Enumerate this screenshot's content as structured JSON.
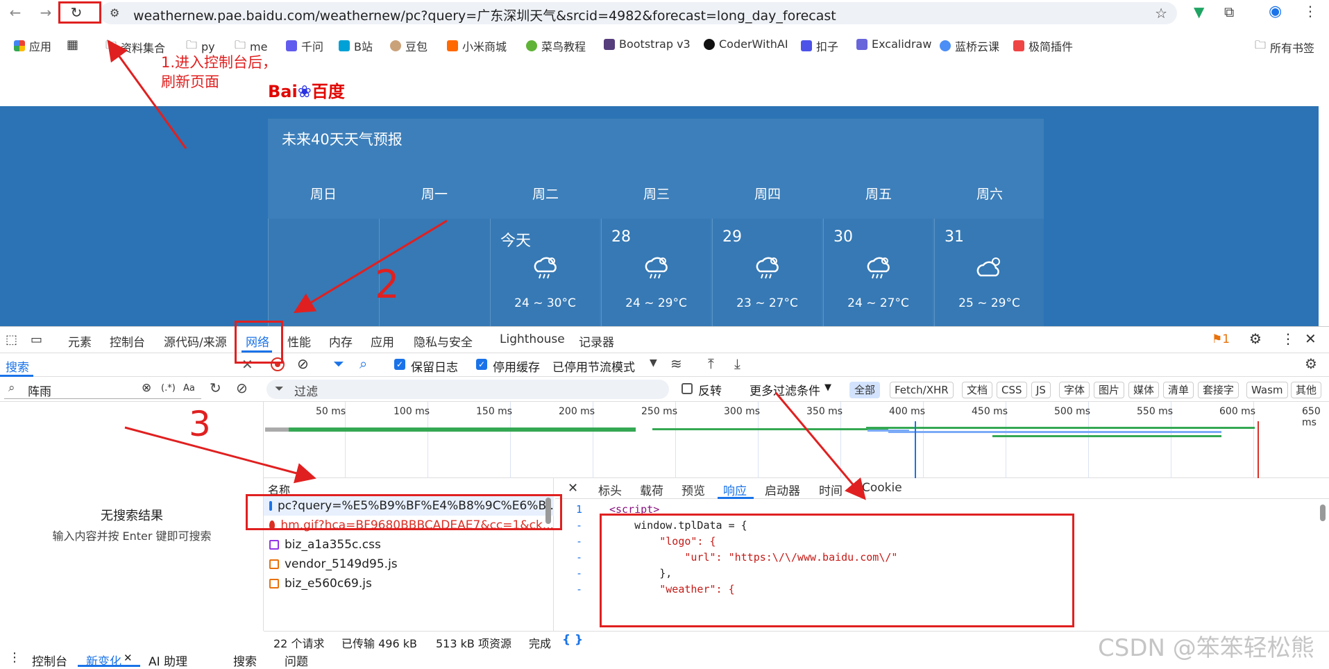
{
  "browser": {
    "url": "weathernew.pae.baidu.com/weathernew/pc?query=广东深圳天气&srcid=4982&forecast=long_day_forecast",
    "bookmarks": [
      "应用",
      "资料集合",
      "py",
      "me",
      "千问",
      "B站",
      "豆包",
      "小米商城",
      "菜鸟教程",
      "Bootstrap v3",
      "CoderWithAI",
      "扣子",
      "Excalidraw",
      "蓝桥云课",
      "极简插件",
      "所有书签"
    ]
  },
  "page": {
    "logo_text": "Bai",
    "logo_text2": "百度",
    "card_title": "未来40天天气预报",
    "weekdays": [
      "周日",
      "周一",
      "周二",
      "周三",
      "周四",
      "周五",
      "周六"
    ],
    "days": [
      {
        "date": "今天",
        "temp": "24 ~ 30°C"
      },
      {
        "date": "28",
        "temp": "24 ~ 29°C"
      },
      {
        "date": "29",
        "temp": "23 ~ 27°C"
      },
      {
        "date": "30",
        "temp": "24 ~ 27°C"
      },
      {
        "date": "31",
        "temp": "25 ~ 29°C"
      }
    ]
  },
  "annotations": {
    "step1": "1.进入控制台后，",
    "step1b": "刷新页面",
    "step2": "2",
    "step3": "3"
  },
  "devtools": {
    "tabs": [
      "元素",
      "控制台",
      "源代码/来源",
      "网络",
      "性能",
      "内存",
      "应用",
      "隐私与安全",
      "Lighthouse",
      "记录器"
    ],
    "issues_count": "1",
    "search_tab": "搜索",
    "preserve_log": "保留日志",
    "disable_cache": "停用缓存",
    "throttle": "已停用节流模式",
    "search_value": "阵雨",
    "regex_label": "(.*)",
    "case_label": "Aa",
    "filter_placeholder": "过滤",
    "invert_label": "反转",
    "more_filters": "更多过滤条件",
    "type_filters": [
      "全部",
      "Fetch/XHR",
      "文档",
      "CSS",
      "JS",
      "字体",
      "图片",
      "媒体",
      "清单",
      "套接字",
      "Wasm",
      "其他"
    ],
    "no_results_title": "无搜索结果",
    "no_results_hint": "输入内容并按 Enter 键即可搜索",
    "timeline_ticks": [
      "50 ms",
      "100 ms",
      "150 ms",
      "200 ms",
      "250 ms",
      "300 ms",
      "350 ms",
      "400 ms",
      "450 ms",
      "500 ms",
      "550 ms",
      "600 ms",
      "650 ms"
    ],
    "name_header": "名称",
    "requests": [
      {
        "name": "pc?query=%E5%B9%BF%E4%B8%9C%E6%B...",
        "type": "doc",
        "color": "#1a73e8"
      },
      {
        "name": "hm.gif?hca=BF9680BBBCADEAE7&cc=1&ck...",
        "type": "error",
        "color": "#d93025"
      },
      {
        "name": "biz_a1a355c.css",
        "type": "css",
        "color": "#9334e6"
      },
      {
        "name": "vendor_5149d95.js",
        "type": "js",
        "color": "#e8710a"
      },
      {
        "name": "biz_e560c69.js",
        "type": "js",
        "color": "#e8710a"
      }
    ],
    "detail_tabs": [
      "标头",
      "载荷",
      "预览",
      "响应",
      "启动器",
      "时间",
      "Cookie"
    ],
    "code_lines": [
      {
        "num": "1",
        "text": "<script>"
      },
      {
        "num": "-",
        "text": "    window.tplData = {"
      },
      {
        "num": "-",
        "text": "        \"logo\": {"
      },
      {
        "num": "-",
        "text": "            \"url\": \"https:\\/\\/www.baidu.com\\/\""
      },
      {
        "num": "-",
        "text": "        },"
      },
      {
        "num": "-",
        "text": "        \"weather\": {"
      }
    ],
    "status": {
      "requests": "22 个请求",
      "transferred": "已传输 496 kB",
      "resources": "513 kB 项资源",
      "finish": "完成"
    },
    "drawer_tabs": [
      "控制台",
      "新变化",
      "AI 助理",
      "搜索",
      "问题"
    ]
  },
  "watermark": "CSDN @笨笨轻松熊"
}
